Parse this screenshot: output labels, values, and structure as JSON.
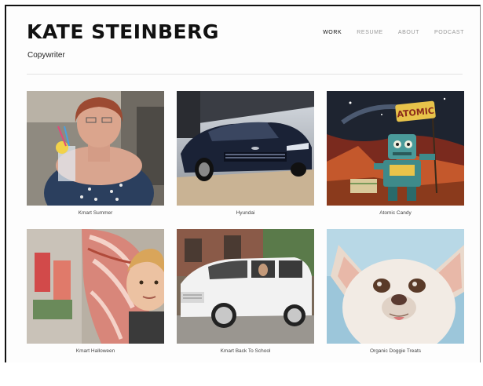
{
  "header": {
    "title": "KATE STEINBERG",
    "subtitle": "Copywriter"
  },
  "nav": [
    {
      "label": "WORK",
      "active": true
    },
    {
      "label": "RESUME",
      "active": false
    },
    {
      "label": "ABOUT",
      "active": false
    },
    {
      "label": "PODCAST",
      "active": false
    }
  ],
  "portfolio": [
    {
      "caption": "Kmart Summer"
    },
    {
      "caption": "Hyundai"
    },
    {
      "caption": "Atomic Candy",
      "sign_text": "ATOMIC"
    },
    {
      "caption": "Kmart Halloween"
    },
    {
      "caption": "Kmart Back To School"
    },
    {
      "caption": "Organic Doggie Treats"
    }
  ]
}
